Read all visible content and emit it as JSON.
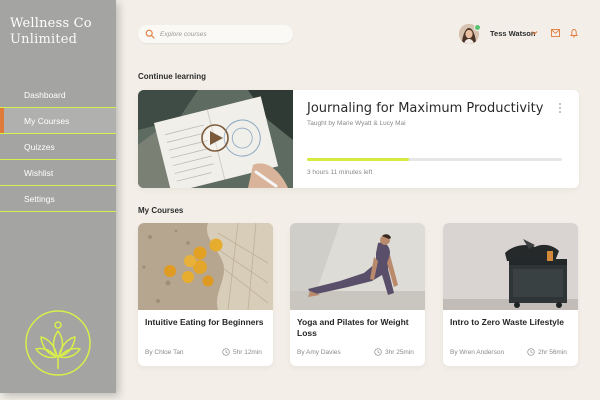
{
  "brand": {
    "line1": "Wellness Co",
    "line2": "Unlimited"
  },
  "sidebar": {
    "items": [
      {
        "label": "Dashboard",
        "active": false
      },
      {
        "label": "My Courses",
        "active": true
      },
      {
        "label": "Quizzes",
        "active": false
      },
      {
        "label": "Wishlist",
        "active": false
      },
      {
        "label": "Settings",
        "active": false
      }
    ],
    "logo_icon": "lotus-icon"
  },
  "header": {
    "search": {
      "placeholder": "Explore courses",
      "value": ""
    },
    "user": {
      "name": "Tess Watson",
      "online": true
    },
    "icons": [
      "search-icon",
      "chevron-down-icon",
      "mail-icon",
      "bell-icon"
    ]
  },
  "continue_learning": {
    "heading": "Continue learning",
    "course": {
      "title": "Journaling for Maximum Productivity",
      "authors": "Taught by Marie Wyatt & Lucy Mai",
      "progress": 0.4,
      "time_left": "3 hours 11 minutes left"
    }
  },
  "my_courses": {
    "heading": "My Courses",
    "items": [
      {
        "title": "Intuitive Eating for Beginners",
        "author": "By Chloe Tan",
        "duration": "5hr 12min"
      },
      {
        "title": "Yoga and Pilates for Weight Loss",
        "author": "By Amy Davies",
        "duration": "3hr 25min"
      },
      {
        "title": "Intro to Zero Waste Lifestyle",
        "author": "By Wren Anderson",
        "duration": "2hr 56min"
      }
    ]
  },
  "colors": {
    "background": "#f3efe8",
    "sidebar": "#a4a4a2",
    "accent_lime": "#d7ea3f",
    "accent_orange": "#e07a3b",
    "online": "#58c271"
  }
}
